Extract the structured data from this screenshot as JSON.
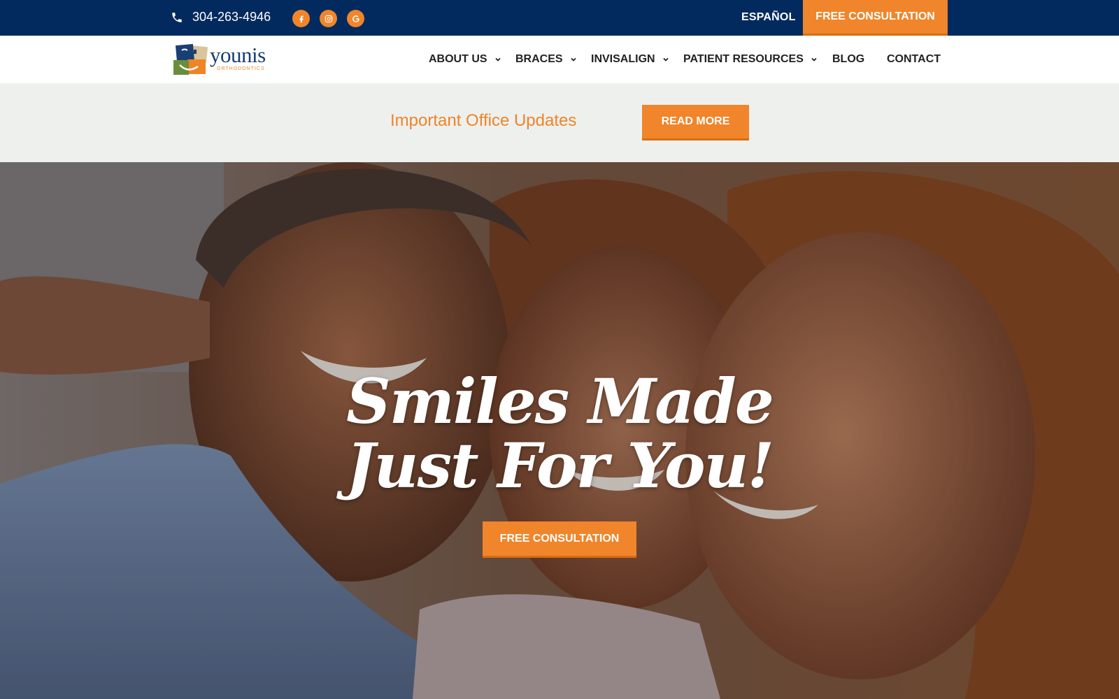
{
  "topbar": {
    "phone": "304-263-4946",
    "phone_icon": "phone-icon",
    "social": [
      "facebook-icon",
      "instagram-icon",
      "google-icon"
    ],
    "language_link": "ESPAÑOL",
    "cta_label": "FREE CONSULTATION"
  },
  "brand": {
    "name": "younis",
    "tagline": "ORTHODONTICS"
  },
  "nav": {
    "items": [
      {
        "label": "ABOUT US",
        "dropdown": true
      },
      {
        "label": "BRACES",
        "dropdown": true
      },
      {
        "label": "INVISALIGN",
        "dropdown": true
      },
      {
        "label": "PATIENT RESOURCES",
        "dropdown": true
      },
      {
        "label": "BLOG",
        "dropdown": false
      },
      {
        "label": "CONTACT",
        "dropdown": false
      }
    ]
  },
  "banner": {
    "text": "Important Office Updates",
    "button_label": "READ MORE"
  },
  "hero": {
    "headline_line1": "Smiles Made",
    "headline_line2": "Just For You!",
    "cta_label": "FREE CONSULTATION"
  },
  "colors": {
    "navy": "#022a5e",
    "orange": "#f0852b",
    "banner_bg": "#eef0ee",
    "nav_text": "#222222"
  }
}
